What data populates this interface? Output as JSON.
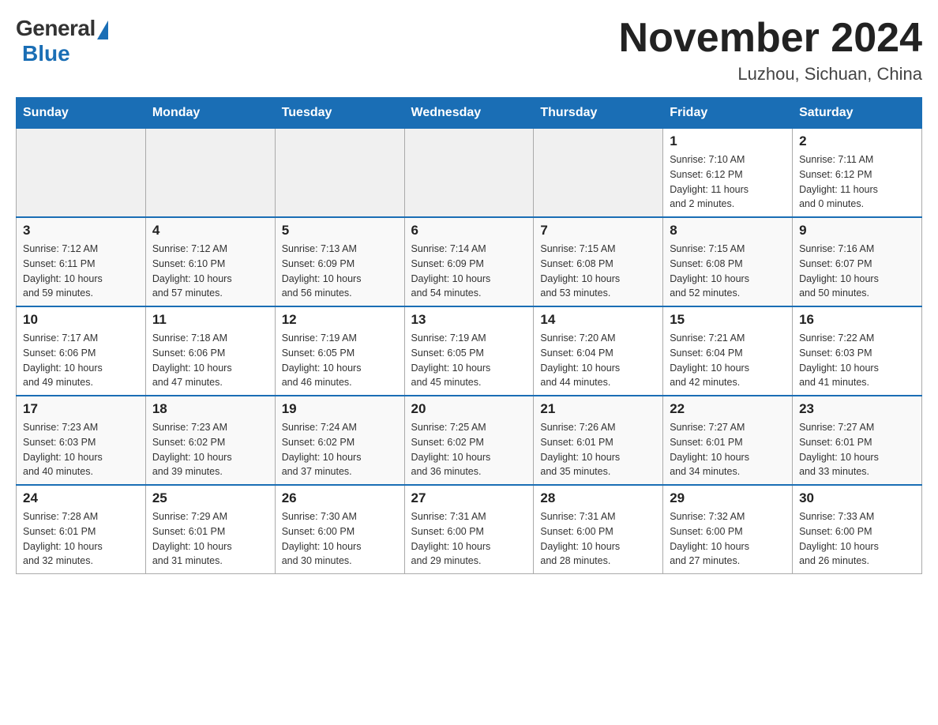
{
  "header": {
    "logo_general": "General",
    "logo_blue": "Blue",
    "title": "November 2024",
    "subtitle": "Luzhou, Sichuan, China"
  },
  "weekdays": [
    "Sunday",
    "Monday",
    "Tuesday",
    "Wednesday",
    "Thursday",
    "Friday",
    "Saturday"
  ],
  "weeks": [
    [
      {
        "day": "",
        "info": ""
      },
      {
        "day": "",
        "info": ""
      },
      {
        "day": "",
        "info": ""
      },
      {
        "day": "",
        "info": ""
      },
      {
        "day": "",
        "info": ""
      },
      {
        "day": "1",
        "info": "Sunrise: 7:10 AM\nSunset: 6:12 PM\nDaylight: 11 hours\nand 2 minutes."
      },
      {
        "day": "2",
        "info": "Sunrise: 7:11 AM\nSunset: 6:12 PM\nDaylight: 11 hours\nand 0 minutes."
      }
    ],
    [
      {
        "day": "3",
        "info": "Sunrise: 7:12 AM\nSunset: 6:11 PM\nDaylight: 10 hours\nand 59 minutes."
      },
      {
        "day": "4",
        "info": "Sunrise: 7:12 AM\nSunset: 6:10 PM\nDaylight: 10 hours\nand 57 minutes."
      },
      {
        "day": "5",
        "info": "Sunrise: 7:13 AM\nSunset: 6:09 PM\nDaylight: 10 hours\nand 56 minutes."
      },
      {
        "day": "6",
        "info": "Sunrise: 7:14 AM\nSunset: 6:09 PM\nDaylight: 10 hours\nand 54 minutes."
      },
      {
        "day": "7",
        "info": "Sunrise: 7:15 AM\nSunset: 6:08 PM\nDaylight: 10 hours\nand 53 minutes."
      },
      {
        "day": "8",
        "info": "Sunrise: 7:15 AM\nSunset: 6:08 PM\nDaylight: 10 hours\nand 52 minutes."
      },
      {
        "day": "9",
        "info": "Sunrise: 7:16 AM\nSunset: 6:07 PM\nDaylight: 10 hours\nand 50 minutes."
      }
    ],
    [
      {
        "day": "10",
        "info": "Sunrise: 7:17 AM\nSunset: 6:06 PM\nDaylight: 10 hours\nand 49 minutes."
      },
      {
        "day": "11",
        "info": "Sunrise: 7:18 AM\nSunset: 6:06 PM\nDaylight: 10 hours\nand 47 minutes."
      },
      {
        "day": "12",
        "info": "Sunrise: 7:19 AM\nSunset: 6:05 PM\nDaylight: 10 hours\nand 46 minutes."
      },
      {
        "day": "13",
        "info": "Sunrise: 7:19 AM\nSunset: 6:05 PM\nDaylight: 10 hours\nand 45 minutes."
      },
      {
        "day": "14",
        "info": "Sunrise: 7:20 AM\nSunset: 6:04 PM\nDaylight: 10 hours\nand 44 minutes."
      },
      {
        "day": "15",
        "info": "Sunrise: 7:21 AM\nSunset: 6:04 PM\nDaylight: 10 hours\nand 42 minutes."
      },
      {
        "day": "16",
        "info": "Sunrise: 7:22 AM\nSunset: 6:03 PM\nDaylight: 10 hours\nand 41 minutes."
      }
    ],
    [
      {
        "day": "17",
        "info": "Sunrise: 7:23 AM\nSunset: 6:03 PM\nDaylight: 10 hours\nand 40 minutes."
      },
      {
        "day": "18",
        "info": "Sunrise: 7:23 AM\nSunset: 6:02 PM\nDaylight: 10 hours\nand 39 minutes."
      },
      {
        "day": "19",
        "info": "Sunrise: 7:24 AM\nSunset: 6:02 PM\nDaylight: 10 hours\nand 37 minutes."
      },
      {
        "day": "20",
        "info": "Sunrise: 7:25 AM\nSunset: 6:02 PM\nDaylight: 10 hours\nand 36 minutes."
      },
      {
        "day": "21",
        "info": "Sunrise: 7:26 AM\nSunset: 6:01 PM\nDaylight: 10 hours\nand 35 minutes."
      },
      {
        "day": "22",
        "info": "Sunrise: 7:27 AM\nSunset: 6:01 PM\nDaylight: 10 hours\nand 34 minutes."
      },
      {
        "day": "23",
        "info": "Sunrise: 7:27 AM\nSunset: 6:01 PM\nDaylight: 10 hours\nand 33 minutes."
      }
    ],
    [
      {
        "day": "24",
        "info": "Sunrise: 7:28 AM\nSunset: 6:01 PM\nDaylight: 10 hours\nand 32 minutes."
      },
      {
        "day": "25",
        "info": "Sunrise: 7:29 AM\nSunset: 6:01 PM\nDaylight: 10 hours\nand 31 minutes."
      },
      {
        "day": "26",
        "info": "Sunrise: 7:30 AM\nSunset: 6:00 PM\nDaylight: 10 hours\nand 30 minutes."
      },
      {
        "day": "27",
        "info": "Sunrise: 7:31 AM\nSunset: 6:00 PM\nDaylight: 10 hours\nand 29 minutes."
      },
      {
        "day": "28",
        "info": "Sunrise: 7:31 AM\nSunset: 6:00 PM\nDaylight: 10 hours\nand 28 minutes."
      },
      {
        "day": "29",
        "info": "Sunrise: 7:32 AM\nSunset: 6:00 PM\nDaylight: 10 hours\nand 27 minutes."
      },
      {
        "day": "30",
        "info": "Sunrise: 7:33 AM\nSunset: 6:00 PM\nDaylight: 10 hours\nand 26 minutes."
      }
    ]
  ]
}
